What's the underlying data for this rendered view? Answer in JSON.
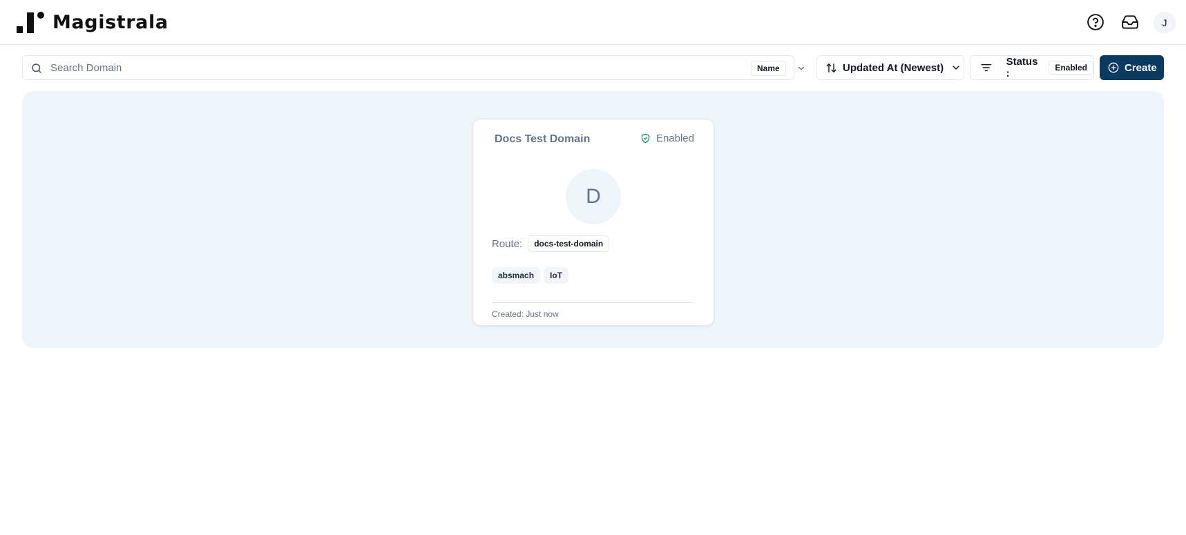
{
  "app": {
    "name": "Magistrala"
  },
  "header": {
    "help_icon": "help-circle-icon",
    "inbox_icon": "inbox-icon",
    "avatar_initial": "J"
  },
  "toolbar": {
    "search_placeholder": "Search Domain",
    "search_field": "Name",
    "sort_label": "Updated At (Newest)",
    "filter_label": "Status :",
    "filter_value": "Enabled",
    "create_label": "Create"
  },
  "domains": [
    {
      "name": "Docs Test Domain",
      "status": "Enabled",
      "initial": "D",
      "route_label": "Route:",
      "route": "docs-test-domain",
      "tags": [
        "absmach",
        "IoT"
      ],
      "created": "Created: Just now"
    }
  ],
  "colors": {
    "brand": "#0b3a61",
    "panel_bg": "#eef5f8",
    "status_enabled": "#0f8a6b",
    "muted_text": "#64748b"
  }
}
